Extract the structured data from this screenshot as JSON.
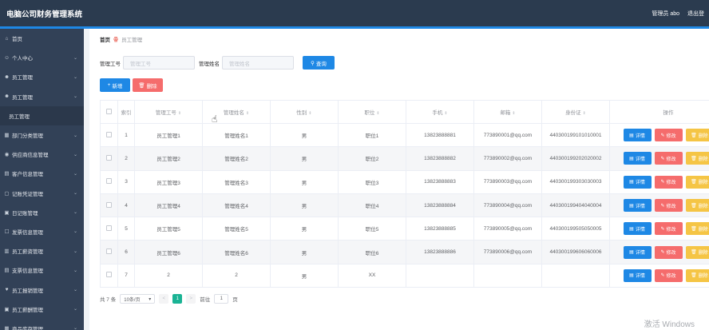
{
  "header": {
    "title": "电脑公司财务管理系统",
    "user": "管理员 abo",
    "logout": "退出登"
  },
  "sidebar": {
    "items": [
      {
        "icon": "⌂",
        "label": "首页",
        "chevron": false,
        "sub": false
      },
      {
        "icon": "☺",
        "label": "个人中心",
        "chevron": true,
        "sub": false
      },
      {
        "icon": "☻",
        "label": "员工管理",
        "chevron": true,
        "sub": false
      },
      {
        "icon": "☻",
        "label": "员工管理",
        "chevron": true,
        "sub": false
      },
      {
        "icon": "",
        "label": "员工管理",
        "chevron": false,
        "sub": true
      },
      {
        "icon": "▦",
        "label": "部门分类管理",
        "chevron": true,
        "sub": false
      },
      {
        "icon": "◉",
        "label": "供应商信息管理",
        "chevron": true,
        "sub": false
      },
      {
        "icon": "▤",
        "label": "客户信息管理",
        "chevron": true,
        "sub": false
      },
      {
        "icon": "▢",
        "label": "记账凭证管理",
        "chevron": true,
        "sub": false
      },
      {
        "icon": "▣",
        "label": "日记账管理",
        "chevron": true,
        "sub": false
      },
      {
        "icon": "☐",
        "label": "发票信息管理",
        "chevron": true,
        "sub": false
      },
      {
        "icon": "▥",
        "label": "员工薪资管理",
        "chevron": true,
        "sub": false
      },
      {
        "icon": "▤",
        "label": "支票信息管理",
        "chevron": true,
        "sub": false
      },
      {
        "icon": "♥",
        "label": "员工报销管理",
        "chevron": true,
        "sub": false
      },
      {
        "icon": "▣",
        "label": "员工薪酬管理",
        "chevron": true,
        "sub": false
      },
      {
        "icon": "▦",
        "label": "商品库存管理",
        "chevron": true,
        "sub": false
      }
    ]
  },
  "breadcrumb": {
    "home": "首页",
    "separator": "ꙮ",
    "current": "员工管理"
  },
  "search": {
    "label1": "管理工号",
    "placeholder1": "管理工号",
    "label2": "管理姓名",
    "placeholder2": "管理姓名",
    "query_label": "查询"
  },
  "actions": {
    "add_label": "新增",
    "delete_label": "删除"
  },
  "table": {
    "headers": {
      "index": "索引",
      "col1": "管理工号",
      "col2": "管理姓名",
      "col3": "性别",
      "col4": "职位",
      "col5": "手机",
      "col6": "邮箱",
      "col7": "身份证",
      "ops": "操作"
    },
    "rows": [
      {
        "index": "1",
        "no": "员工管理1",
        "name": "管理姓名1",
        "gender": "男",
        "position": "职位1",
        "phone": "13823888881",
        "email": "773890001@qq.com",
        "idcard": "440300199101010001"
      },
      {
        "index": "2",
        "no": "员工管理2",
        "name": "管理姓名2",
        "gender": "男",
        "position": "职位2",
        "phone": "13823888882",
        "email": "773890002@qq.com",
        "idcard": "440300199202020002"
      },
      {
        "index": "3",
        "no": "员工管理3",
        "name": "管理姓名3",
        "gender": "男",
        "position": "职位3",
        "phone": "13823888883",
        "email": "773890003@qq.com",
        "idcard": "440300199303030003"
      },
      {
        "index": "4",
        "no": "员工管理4",
        "name": "管理姓名4",
        "gender": "男",
        "position": "职位4",
        "phone": "13823888884",
        "email": "773890004@qq.com",
        "idcard": "440300199404040004"
      },
      {
        "index": "5",
        "no": "员工管理5",
        "name": "管理姓名5",
        "gender": "男",
        "position": "职位5",
        "phone": "13823888885",
        "email": "773890005@qq.com",
        "idcard": "440300199505050005"
      },
      {
        "index": "6",
        "no": "员工管理6",
        "name": "管理姓名6",
        "gender": "男",
        "position": "职位6",
        "phone": "13823888886",
        "email": "773890006@qq.com",
        "idcard": "440300199606060006"
      },
      {
        "index": "7",
        "no": "2",
        "name": "2",
        "gender": "男",
        "position": "XX",
        "phone": "",
        "email": "",
        "idcard": ""
      }
    ],
    "op_labels": {
      "detail": "详情",
      "edit": "修改",
      "delete": "删除"
    }
  },
  "pagination": {
    "total": "共 7 条",
    "page_size": "10条/页",
    "prev": "<",
    "current": "1",
    "next": ">",
    "goto_label": "前往",
    "goto_value": "1",
    "page_suffix": "页"
  },
  "watermark": "激活 Windows"
}
